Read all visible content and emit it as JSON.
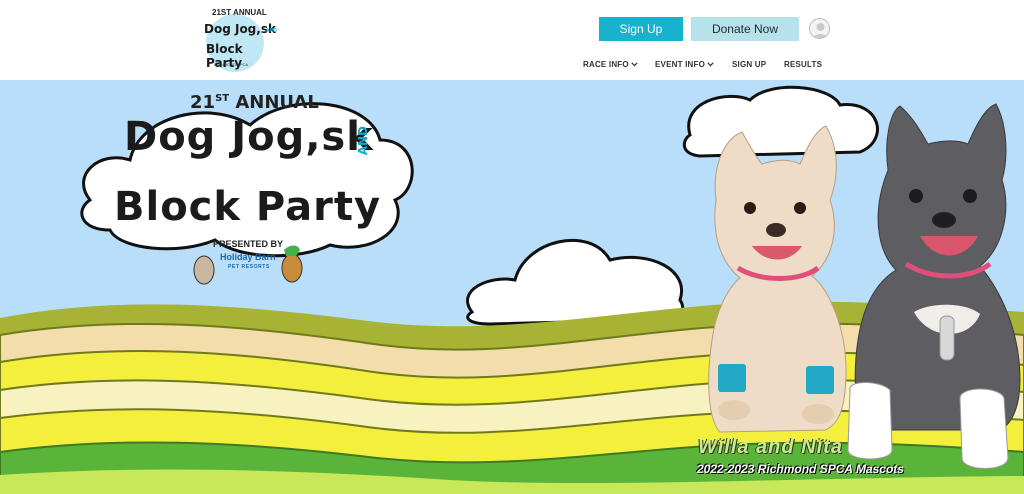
{
  "logo": {
    "annual": "21ST ANNUAL",
    "line1": "Dog Jog,sk",
    "and": "AND",
    "line2": "Block Party",
    "sub": "RICHMOND SPCA"
  },
  "header": {
    "signup_label": "Sign Up",
    "donate_label": "Donate Now",
    "avatar_icon": "user-avatar-icon"
  },
  "nav": {
    "items": [
      {
        "label": "RACE INFO",
        "has_dropdown": true
      },
      {
        "label": "EVENT INFO",
        "has_dropdown": true
      },
      {
        "label": "SIGN UP",
        "has_dropdown": false
      },
      {
        "label": "RESULTS",
        "has_dropdown": false
      }
    ]
  },
  "hero": {
    "annual_number": "21",
    "annual_suffix": "ST",
    "annual_word": "ANNUAL",
    "title_line1": "Dog Jog,sk",
    "title_and": "AND",
    "title_line2": "Block Party",
    "presented_by": "PRESENTED BY",
    "sponsor_name": "Holiday Barn",
    "sponsor_sub": "PET RESORTS",
    "caption_names": "Willa and Nita",
    "caption_sub": "2022-2023 Richmond SPCA Mascots"
  },
  "colors": {
    "accent": "#19b2ce",
    "donate_bg": "#b6e2ec",
    "sky": "#b8defa",
    "hill_olive": "#a7b334",
    "hill_yellow": "#f3ef3c",
    "hill_cream": "#f8f2c0",
    "hill_tan": "#f2ddab",
    "hill_green": "#5bb43a"
  }
}
